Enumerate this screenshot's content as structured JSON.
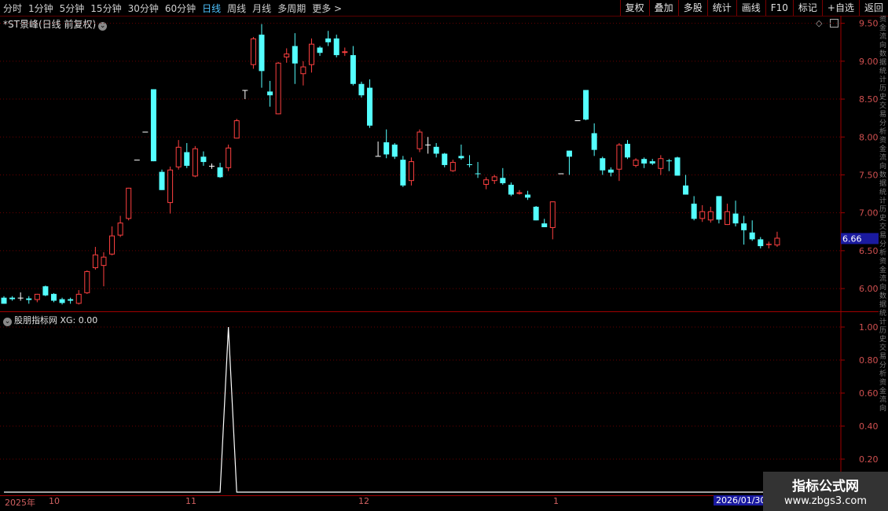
{
  "toolbar": {
    "periods": [
      "分时",
      "1分钟",
      "5分钟",
      "15分钟",
      "30分钟",
      "60分钟",
      "日线",
      "周线",
      "月线",
      "多周期",
      "更多 >"
    ],
    "active_period": "日线",
    "tools": [
      "复权",
      "叠加",
      "多股",
      "统计",
      "画线",
      "F10",
      "标记",
      "+自选",
      "返回"
    ]
  },
  "chart_title": "*ST景峰(日线 前复权)",
  "indicator_title": "股朋指标网  XG: 0.00",
  "current_price_label": "6.66",
  "date_axis": {
    "labels": [
      "2025年",
      "10",
      "11",
      "12",
      "1"
    ],
    "end_label": "2026/01/30"
  },
  "watermark": {
    "line1": "指标公式网",
    "line2": "www.zbgs3.com"
  },
  "colors": {
    "up": "#ff4040",
    "down": "#54ffff",
    "background": "#000000",
    "grid": "#6a0000",
    "indicator": "#ffffff"
  },
  "chart_data": [
    {
      "type": "candlestick",
      "ylim": [
        5.7,
        9.6
      ],
      "yticks": [
        "9.50",
        "9.00",
        "8.50",
        "8.00",
        "7.50",
        "7.00",
        "6.50",
        "6.00"
      ],
      "candles": [
        [
          5.88,
          5.8,
          5.9,
          5.8
        ],
        [
          5.88,
          5.86,
          5.9,
          5.84
        ],
        [
          5.88,
          5.88,
          5.95,
          5.84
        ],
        [
          5.87,
          5.85,
          5.9,
          5.8
        ],
        [
          5.85,
          5.93,
          5.93,
          5.82
        ],
        [
          6.03,
          5.91,
          6.04,
          5.9
        ],
        [
          5.93,
          5.84,
          5.94,
          5.82
        ],
        [
          5.86,
          5.81,
          5.88,
          5.79
        ],
        [
          5.86,
          5.84,
          5.88,
          5.8
        ],
        [
          5.8,
          5.93,
          5.98,
          5.79
        ],
        [
          5.94,
          6.23,
          6.24,
          5.93
        ],
        [
          6.27,
          6.45,
          6.55,
          6.25
        ],
        [
          6.3,
          6.42,
          6.48,
          6.03
        ],
        [
          6.45,
          6.7,
          6.82,
          6.44
        ],
        [
          6.7,
          6.87,
          6.96,
          6.68
        ],
        [
          6.92,
          7.33,
          7.33,
          6.9
        ],
        [
          7.7,
          7.7,
          7.7,
          7.7
        ],
        [
          8.07,
          8.07,
          8.07,
          8.07
        ],
        [
          8.63,
          7.68,
          8.63,
          7.68
        ],
        [
          7.54,
          7.3,
          7.57,
          7.3
        ],
        [
          7.13,
          7.57,
          7.61,
          6.99
        ],
        [
          7.6,
          7.87,
          7.96,
          7.57
        ],
        [
          7.8,
          7.62,
          7.92,
          7.59
        ],
        [
          7.48,
          7.85,
          7.88,
          7.47
        ],
        [
          7.74,
          7.67,
          7.81,
          7.62
        ],
        [
          7.62,
          7.62,
          7.65,
          7.58
        ],
        [
          7.6,
          7.47,
          7.66,
          7.46
        ],
        [
          7.59,
          7.86,
          7.9,
          7.55
        ],
        [
          7.98,
          8.22,
          8.24,
          7.98
        ],
        [
          8.62,
          8.62,
          8.62,
          8.5
        ],
        [
          8.95,
          9.3,
          9.32,
          8.9
        ],
        [
          9.35,
          8.87,
          9.49,
          8.65
        ],
        [
          8.6,
          8.55,
          8.74,
          8.4
        ],
        [
          8.3,
          8.98,
          8.99,
          8.3
        ],
        [
          9.05,
          9.1,
          9.17,
          8.98
        ],
        [
          9.2,
          8.97,
          9.37,
          8.7
        ],
        [
          8.83,
          8.93,
          9.0,
          8.68
        ],
        [
          8.95,
          9.23,
          9.3,
          8.85
        ],
        [
          9.18,
          9.11,
          9.2,
          9.07
        ],
        [
          9.3,
          9.25,
          9.4,
          9.2
        ],
        [
          9.3,
          9.08,
          9.35,
          9.05
        ],
        [
          9.11,
          9.13,
          9.18,
          9.07
        ],
        [
          9.08,
          8.7,
          9.2,
          8.68
        ],
        [
          8.7,
          8.55,
          8.73,
          8.52
        ],
        [
          8.65,
          8.15,
          8.76,
          8.12
        ],
        [
          7.75,
          7.75,
          7.94,
          7.75
        ],
        [
          7.93,
          7.77,
          8.1,
          7.72
        ],
        [
          7.9,
          7.74,
          7.92,
          7.71
        ],
        [
          7.7,
          7.36,
          7.75,
          7.34
        ],
        [
          7.42,
          7.68,
          7.73,
          7.36
        ],
        [
          7.84,
          8.07,
          8.1,
          7.8
        ],
        [
          7.9,
          7.9,
          8.0,
          7.78
        ],
        [
          7.87,
          7.78,
          7.92,
          7.73
        ],
        [
          7.78,
          7.63,
          7.79,
          7.6
        ],
        [
          7.55,
          7.67,
          7.7,
          7.54
        ],
        [
          7.75,
          7.72,
          7.9,
          7.7
        ],
        [
          7.64,
          7.63,
          7.76,
          7.6
        ],
        [
          7.52,
          7.51,
          7.67,
          7.46
        ],
        [
          7.37,
          7.44,
          7.47,
          7.31
        ],
        [
          7.42,
          7.48,
          7.5,
          7.38
        ],
        [
          7.46,
          7.39,
          7.59,
          7.37
        ],
        [
          7.37,
          7.24,
          7.4,
          7.22
        ],
        [
          7.25,
          7.27,
          7.3,
          7.24
        ],
        [
          7.24,
          7.2,
          7.29,
          7.17
        ],
        [
          7.08,
          6.9,
          7.09,
          6.9
        ],
        [
          6.86,
          6.81,
          6.92,
          6.81
        ],
        [
          6.8,
          7.15,
          7.15,
          6.65
        ],
        [
          7.52,
          7.52,
          7.52,
          7.52
        ],
        [
          7.82,
          7.74,
          7.82,
          7.5
        ],
        [
          8.22,
          8.22,
          8.22,
          8.22
        ],
        [
          8.62,
          8.23,
          8.62,
          8.22
        ],
        [
          8.05,
          7.83,
          8.18,
          7.75
        ],
        [
          7.72,
          7.56,
          7.74,
          7.5
        ],
        [
          7.57,
          7.53,
          7.6,
          7.48
        ],
        [
          7.57,
          7.9,
          7.92,
          7.42
        ],
        [
          7.91,
          7.73,
          7.96,
          7.71
        ],
        [
          7.62,
          7.7,
          7.72,
          7.6
        ],
        [
          7.71,
          7.65,
          7.73,
          7.59
        ],
        [
          7.68,
          7.65,
          7.71,
          7.63
        ],
        [
          7.58,
          7.72,
          7.76,
          7.5
        ],
        [
          7.69,
          7.68,
          7.71,
          7.55
        ],
        [
          7.73,
          7.49,
          7.74,
          7.49
        ],
        [
          7.36,
          7.24,
          7.5,
          7.24
        ],
        [
          7.12,
          6.92,
          7.22,
          6.9
        ],
        [
          6.92,
          7.02,
          7.1,
          6.88
        ],
        [
          6.9,
          7.02,
          7.08,
          6.87
        ],
        [
          7.22,
          6.91,
          7.22,
          6.86
        ],
        [
          6.84,
          7.02,
          7.12,
          6.84
        ],
        [
          6.99,
          6.86,
          7.16,
          6.82
        ],
        [
          6.86,
          6.77,
          6.96,
          6.58
        ],
        [
          6.74,
          6.65,
          6.9,
          6.63
        ],
        [
          6.65,
          6.56,
          6.68,
          6.53
        ],
        [
          6.58,
          6.59,
          6.62,
          6.53
        ],
        [
          6.57,
          6.67,
          6.75,
          6.55
        ]
      ]
    },
    {
      "type": "line",
      "name": "XG",
      "ylim": [
        0,
        1.1
      ],
      "yticks": [
        "1.00",
        "0.80",
        "0.60",
        "0.40",
        "0.20"
      ],
      "values": [
        0,
        0,
        0,
        0,
        0,
        0,
        0,
        0,
        0,
        0,
        0,
        0,
        0,
        0,
        0,
        0,
        0,
        0,
        0,
        0,
        0,
        0,
        0,
        0,
        0,
        0,
        0,
        1,
        0,
        0,
        0,
        0,
        0,
        0,
        0,
        0,
        0,
        0,
        0,
        0,
        0,
        0,
        0,
        0,
        0,
        0,
        0,
        0,
        0,
        0,
        0,
        0,
        0,
        0,
        0,
        0,
        0,
        0,
        0,
        0,
        0,
        0,
        0,
        0,
        0,
        0,
        0,
        0,
        0,
        0,
        0,
        0,
        0,
        0,
        0,
        0,
        0,
        0,
        0,
        0,
        0,
        0,
        0,
        0,
        0,
        0,
        0,
        0,
        0,
        0,
        0,
        0,
        0,
        0,
        0,
        0,
        0,
        0,
        0,
        0,
        0,
        0,
        0,
        0,
        0,
        0
      ]
    }
  ]
}
